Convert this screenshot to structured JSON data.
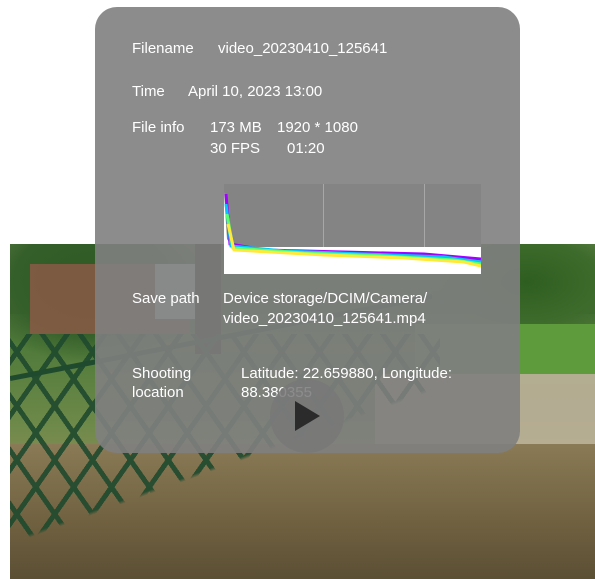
{
  "info": {
    "filename_label": "Filename",
    "filename_value": "video_20230410_125641",
    "time_label": "Time",
    "time_value": "April 10, 2023 13:00",
    "fileinfo_label": "File info",
    "fileinfo_size": "173 MB",
    "fileinfo_resolution": "1920 * 1080",
    "fileinfo_fps": "30 FPS",
    "fileinfo_duration": "01:20",
    "savepath_label": "Save path",
    "savepath_line1": "Device storage/DCIM/Camera/",
    "savepath_line2": "video_20230410_125641.mp4",
    "location_label_line1": "Shooting",
    "location_label_line2": "location",
    "location_line1": "Latitude: 22.659880, Longitude:",
    "location_line2": "88.380355"
  },
  "icons": {
    "play": "play-icon"
  },
  "colors": {
    "panel_bg": "#808080",
    "text": "#ffffff"
  }
}
